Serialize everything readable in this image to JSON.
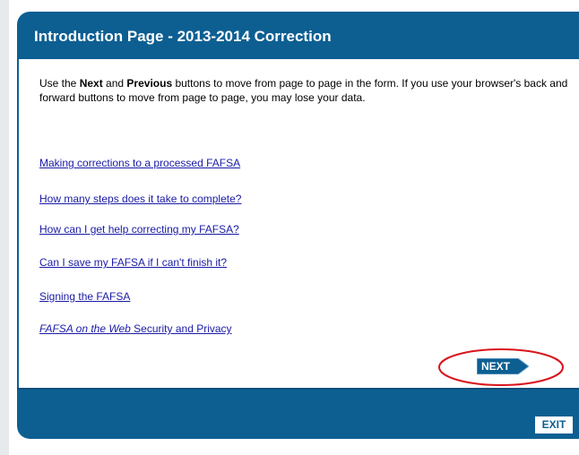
{
  "page": {
    "title": "Introduction Page - 2013-2014 Correction"
  },
  "intro": {
    "part1": "Use the ",
    "next_word": "Next",
    "part2": " and ",
    "previous_word": "Previous",
    "part3": " buttons to move from page to page in the form. If you use your browser's back and forward buttons to move from page to page, you may lose your data."
  },
  "links": [
    {
      "label": "Making corrections to a processed FAFSA"
    },
    {
      "label": "How many steps does it take to complete?"
    },
    {
      "label": "How can I get help correcting my FAFSA?"
    },
    {
      "label": "Can I save my FAFSA if I can't finish it?"
    },
    {
      "label": "Signing the FAFSA"
    },
    {
      "label_italic": "FAFSA on the Web",
      "label_rest": " Security and Privacy"
    }
  ],
  "buttons": {
    "next_label": "NEXT",
    "exit_label": "EXIT"
  },
  "colors": {
    "brand_blue": "#0d5f92",
    "link_blue": "#1a1aa6",
    "highlight_red": "#d9141c"
  },
  "icons": {
    "next_arrow": "right-arrow-icon"
  }
}
